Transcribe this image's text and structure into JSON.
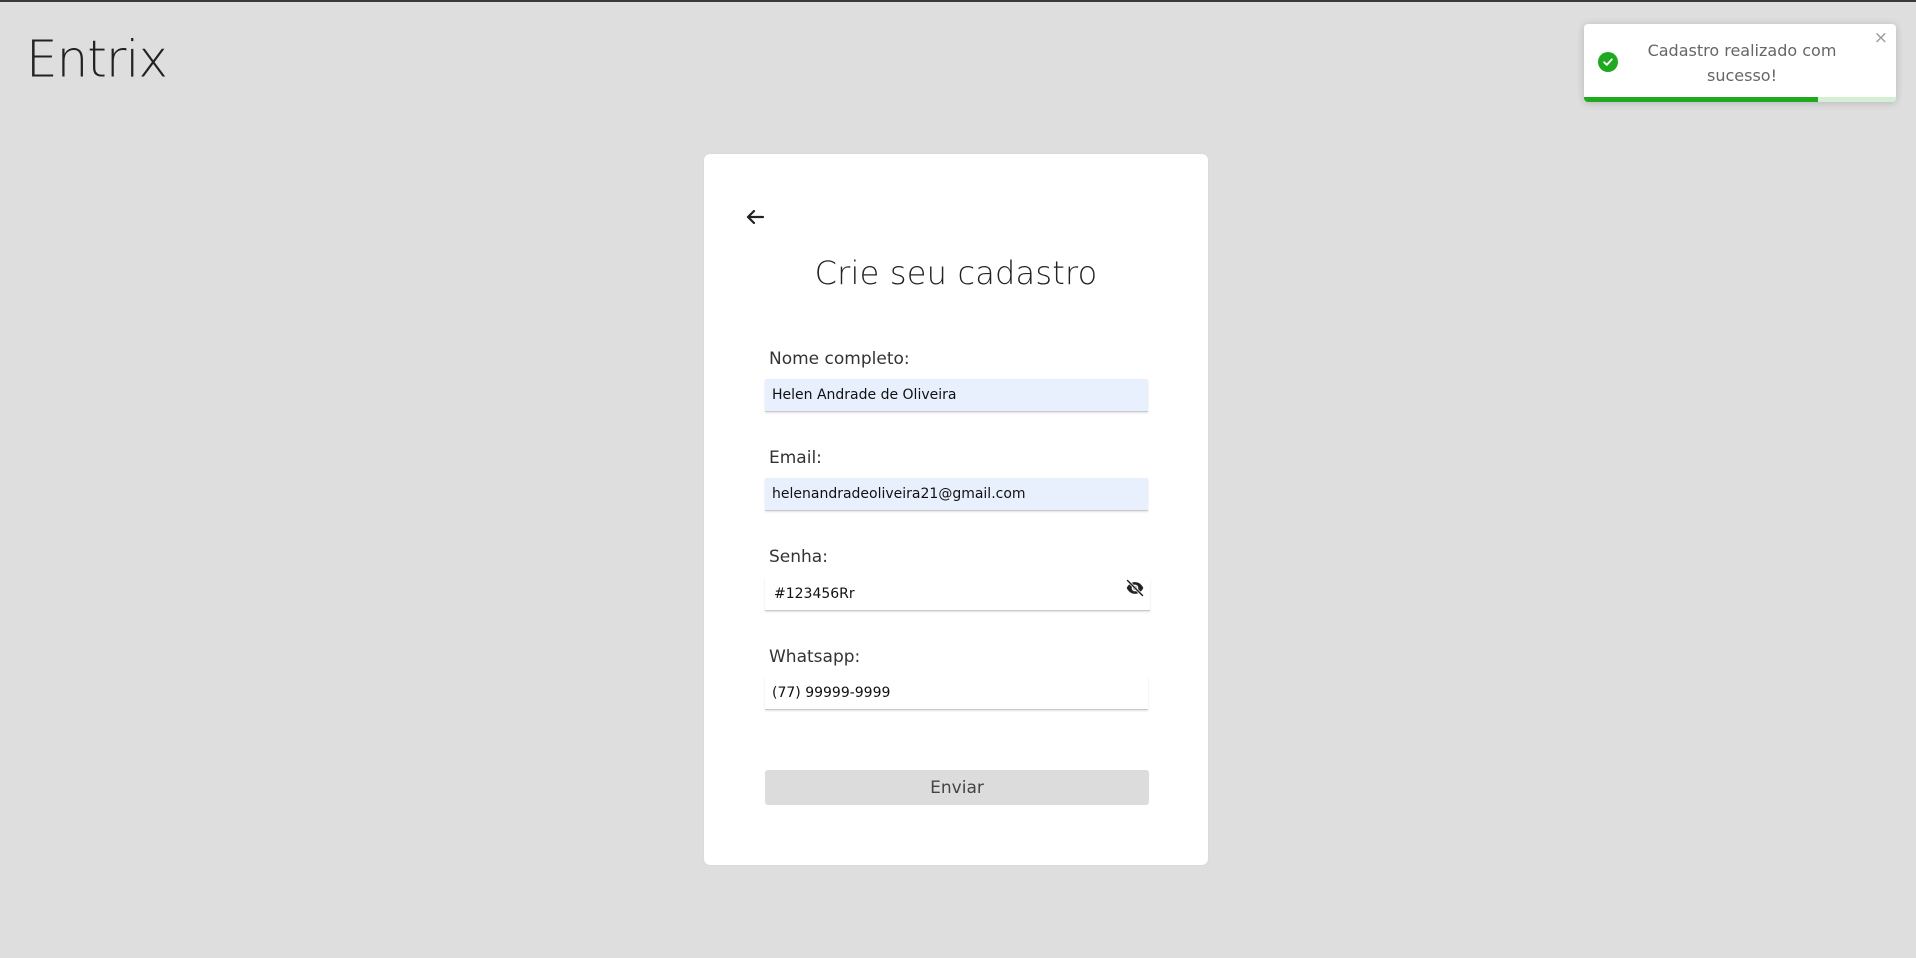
{
  "app": {
    "brand": "Entrix"
  },
  "toast": {
    "message": "Cadastro realizado com sucesso!",
    "close_symbol": "×",
    "type": "success",
    "icon": "check-circle-icon",
    "progress": 0.75,
    "accent_color": "#1fa91f"
  },
  "form": {
    "back_icon": "arrow-left-icon",
    "title": "Crie seu cadastro",
    "fields": {
      "name": {
        "label": "Nome completo:",
        "value": "Helen Andrade de Oliveira"
      },
      "email": {
        "label": "Email:",
        "value": "helenandradeoliveira21@gmail.com"
      },
      "password": {
        "label": "Senha:",
        "value": "#123456Rr",
        "toggle_icon": "eye-off-icon"
      },
      "whatsapp": {
        "label": "Whatsapp:",
        "value": "(77) 99999-9999"
      }
    },
    "submit_label": "Enviar"
  }
}
